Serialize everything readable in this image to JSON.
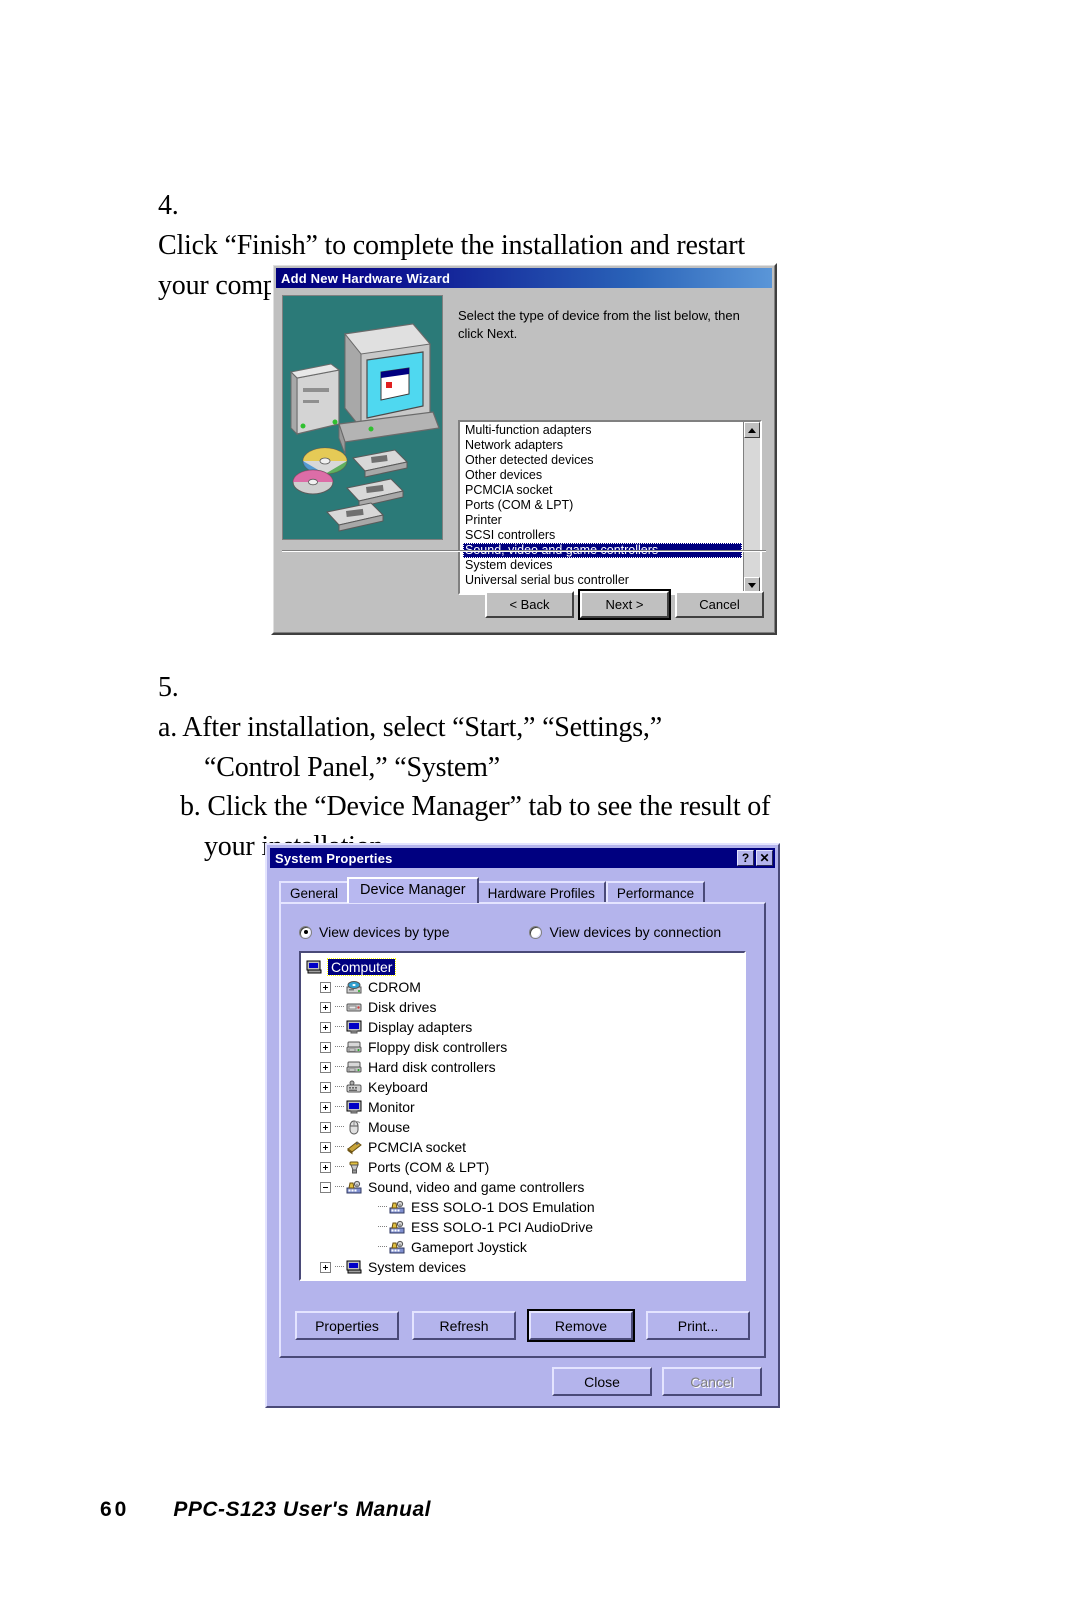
{
  "steps": [
    {
      "number": "4.",
      "lines": [
        "Click “Finish” to complete the installation and restart",
        "your computer."
      ]
    },
    {
      "number": "5.",
      "lines": [
        "a. After installation, select “Start,” “Settings,”",
        "“Control Panel,” “System”",
        "b. Click the “Device Manager” tab to see the result of",
        "your installation."
      ]
    }
  ],
  "wizard": {
    "title": "Add New Hardware Wizard",
    "instruction": "Select the type of device from the list below, then click Next.",
    "list": [
      "Multi-function adapters",
      "Network adapters",
      "Other detected devices",
      "Other devices",
      "PCMCIA socket",
      "Ports (COM & LPT)",
      "Printer",
      "SCSI controllers",
      "Sound, video and game controllers",
      "System devices",
      "Universal serial bus controller"
    ],
    "selected_index": 8,
    "buttons": [
      {
        "label": "< Back",
        "accel": "B",
        "default": false,
        "disabled": false
      },
      {
        "label": "Next >",
        "accel": "",
        "default": true,
        "disabled": false
      },
      {
        "label": "Cancel",
        "accel": "",
        "default": false,
        "disabled": false
      }
    ],
    "scrollbar": {
      "up_icon": "arrow-up-icon",
      "down_icon": "arrow-down-icon"
    }
  },
  "system_properties": {
    "title": "System Properties",
    "title_buttons": [
      {
        "name": "help-button",
        "glyph": "?"
      },
      {
        "name": "close-button",
        "glyph": "✕"
      }
    ],
    "tabs": [
      {
        "label": "General",
        "active": false
      },
      {
        "label": "Device Manager",
        "active": true
      },
      {
        "label": "Hardware Profiles",
        "active": false
      },
      {
        "label": "Performance",
        "active": false
      }
    ],
    "view_options": [
      {
        "label": "View devices by type",
        "accel": "t",
        "selected": true
      },
      {
        "label": "View devices by connection",
        "accel": "c",
        "selected": false
      }
    ],
    "tree": [
      {
        "label": "Computer",
        "level": 1,
        "expander": "none",
        "icon": "computer-icon",
        "selected": true
      },
      {
        "label": "CDROM",
        "level": 2,
        "expander": "plus",
        "icon": "cdrom-icon",
        "selected": false
      },
      {
        "label": "Disk drives",
        "level": 2,
        "expander": "plus",
        "icon": "disk-drive-icon",
        "selected": false
      },
      {
        "label": "Display adapters",
        "level": 2,
        "expander": "plus",
        "icon": "display-adapter-icon",
        "selected": false
      },
      {
        "label": "Floppy disk controllers",
        "level": 2,
        "expander": "plus",
        "icon": "floppy-controller-icon",
        "selected": false
      },
      {
        "label": "Hard disk controllers",
        "level": 2,
        "expander": "plus",
        "icon": "hard-disk-controller-icon",
        "selected": false
      },
      {
        "label": "Keyboard",
        "level": 2,
        "expander": "plus",
        "icon": "keyboard-icon",
        "selected": false
      },
      {
        "label": "Monitor",
        "level": 2,
        "expander": "plus",
        "icon": "monitor-icon",
        "selected": false
      },
      {
        "label": "Mouse",
        "level": 2,
        "expander": "plus",
        "icon": "mouse-icon",
        "selected": false
      },
      {
        "label": "PCMCIA socket",
        "level": 2,
        "expander": "plus",
        "icon": "pcmcia-icon",
        "selected": false
      },
      {
        "label": "Ports (COM & LPT)",
        "level": 2,
        "expander": "plus",
        "icon": "port-icon",
        "selected": false
      },
      {
        "label": "Sound, video and game controllers",
        "level": 2,
        "expander": "minus",
        "icon": "sound-controller-icon",
        "selected": false
      },
      {
        "label": "ESS SOLO-1 DOS Emulation",
        "level": 3,
        "expander": "none",
        "icon": "sound-device-icon",
        "selected": false
      },
      {
        "label": "ESS SOLO-1 PCI AudioDrive",
        "level": 3,
        "expander": "none",
        "icon": "sound-device-icon",
        "selected": false
      },
      {
        "label": "Gameport Joystick",
        "level": 3,
        "expander": "none",
        "icon": "sound-device-icon",
        "selected": false
      },
      {
        "label": "System devices",
        "level": 2,
        "expander": "plus",
        "icon": "system-device-icon",
        "selected": false
      }
    ],
    "action_buttons": [
      {
        "label": "Properties",
        "accel": "r",
        "default": false,
        "disabled": false
      },
      {
        "label": "Refresh",
        "accel": "f",
        "default": false,
        "disabled": false
      },
      {
        "label": "Remove",
        "accel": "e",
        "default": true,
        "disabled": false
      },
      {
        "label": "Print...",
        "accel": "n",
        "default": false,
        "disabled": false
      }
    ],
    "footer_buttons": [
      {
        "label": "Close",
        "default": false,
        "disabled": false
      },
      {
        "label": "Cancel",
        "default": false,
        "disabled": true
      }
    ]
  },
  "page_footer": {
    "page_number": "60",
    "manual_title": "PPC-S123  User's Manual"
  },
  "colors": {
    "titlebar_blue": "#000080",
    "selection_blue": "#000080",
    "dialog_face": "#c0c0c0",
    "sysprops_face": "#b4b4ec",
    "wizard_graphic_bg": "#2b7a78"
  }
}
